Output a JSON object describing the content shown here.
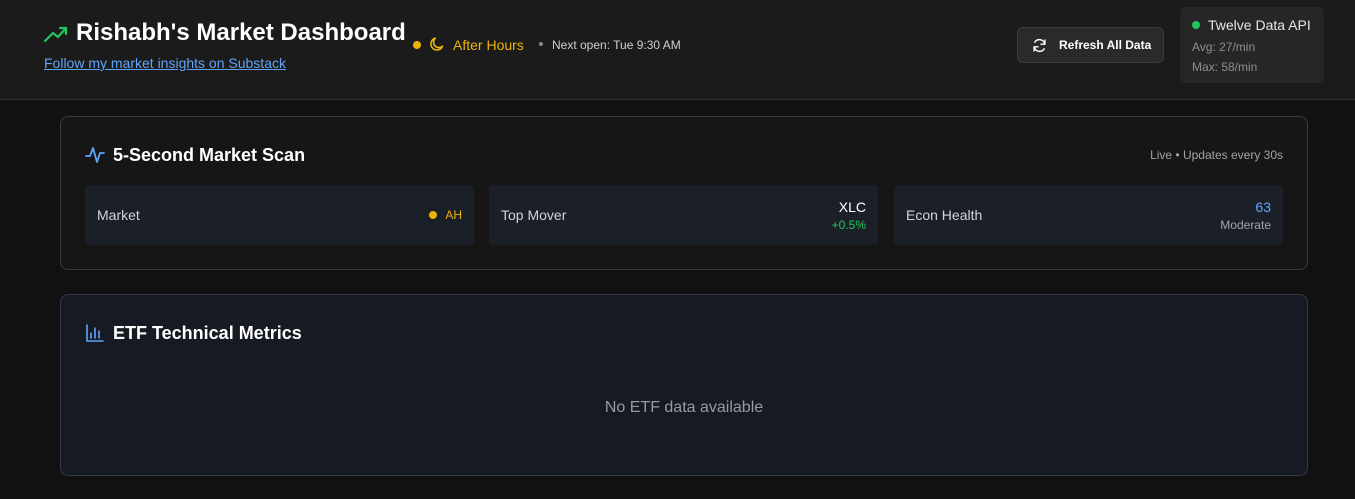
{
  "header": {
    "title": "Rishabh's Market Dashboard",
    "title_icon": "trending-up-icon",
    "substack_link": "Follow my market insights on Substack",
    "market_status": {
      "label": "After Hours",
      "icon": "moon-icon",
      "next_open": "Next open: Tue 9:30 AM"
    },
    "refresh_button": {
      "label": "Refresh All Data",
      "icon": "refresh-icon"
    },
    "api": {
      "name": "Twelve Data API",
      "avg": "Avg: 27/min",
      "max": "Max: 58/min"
    }
  },
  "market_scan": {
    "title": "5-Second Market Scan",
    "icon": "activity-pulse-icon",
    "live_label": "Live • Updates every 30s",
    "tiles": {
      "market": {
        "label": "Market",
        "value": "AH"
      },
      "top_mover": {
        "label": "Top Mover",
        "symbol": "XLC",
        "change": "+0.5%"
      },
      "econ_health": {
        "label": "Econ Health",
        "score": "63",
        "status": "Moderate"
      }
    }
  },
  "etf_metrics": {
    "title": "ETF Technical Metrics",
    "icon": "bar-chart-icon",
    "empty_message": "No ETF data available"
  },
  "colors": {
    "accent_yellow": "#eab308",
    "accent_green": "#22c55e",
    "accent_blue": "#60a5fa",
    "background": "#111111",
    "header_bg": "#1b1b1b"
  }
}
